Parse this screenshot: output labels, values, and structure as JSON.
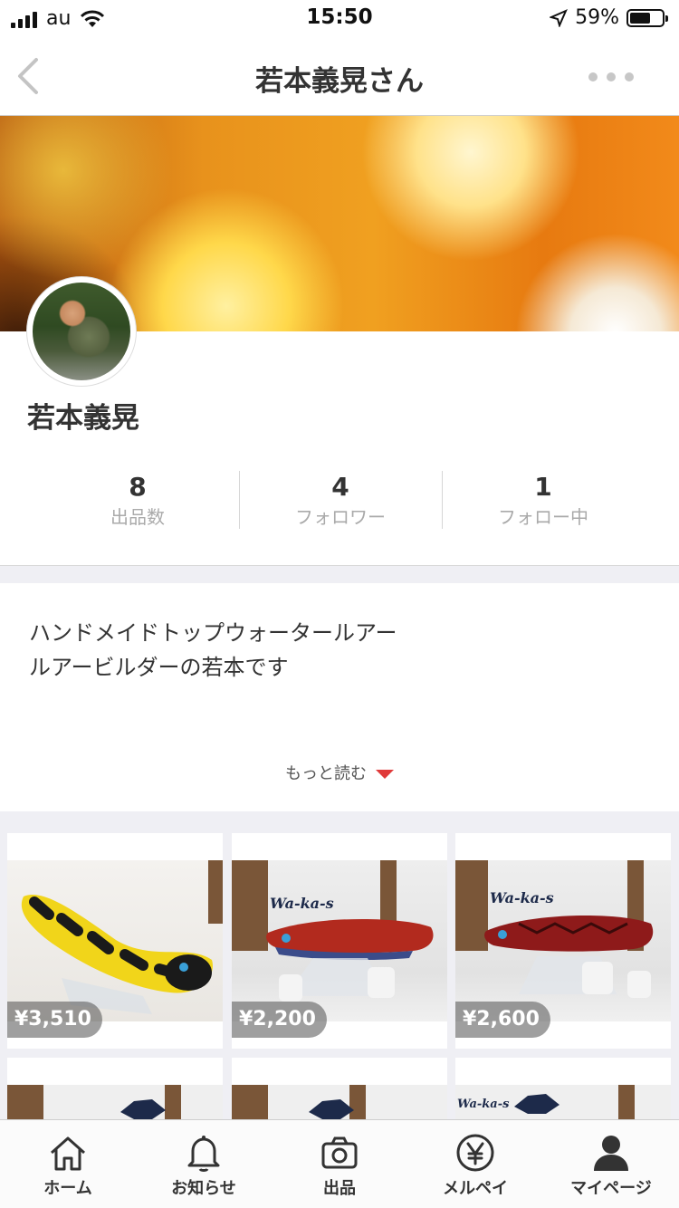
{
  "status_bar": {
    "carrier": "au",
    "time": "15:50",
    "battery": "59%"
  },
  "nav": {
    "title": "若本義晃さん"
  },
  "profile": {
    "name": "若本義晃",
    "stats": [
      {
        "value": "8",
        "label": "出品数"
      },
      {
        "value": "4",
        "label": "フォロワー"
      },
      {
        "value": "1",
        "label": "フォロー中"
      }
    ],
    "bio_line1": "ハンドメイドトップウォータールアー",
    "bio_line2": "ルアービルダーの若本です",
    "read_more": "もっと読む"
  },
  "items": [
    {
      "price": "¥3,510",
      "logo": ""
    },
    {
      "price": "¥2,200",
      "logo": "Wa-ka-s"
    },
    {
      "price": "¥2,600",
      "logo": "Wa-ka-s"
    },
    {
      "price": "",
      "logo": ""
    },
    {
      "price": "",
      "logo": ""
    },
    {
      "price": "",
      "logo": "Wa-ka-s"
    }
  ],
  "tabs": [
    {
      "label": "ホーム",
      "icon": "home-icon"
    },
    {
      "label": "お知らせ",
      "icon": "bell-icon"
    },
    {
      "label": "出品",
      "icon": "camera-icon"
    },
    {
      "label": "メルペイ",
      "icon": "yen-icon"
    },
    {
      "label": "マイページ",
      "icon": "person-icon"
    }
  ]
}
